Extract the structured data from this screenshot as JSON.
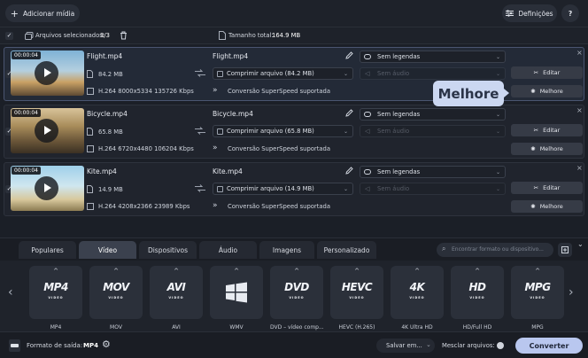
{
  "toolbar": {
    "add_media": "Adicionar mídia",
    "settings": "Definições",
    "help": "?"
  },
  "selection": {
    "label": "Arquivos selecionados:",
    "count": "3/3",
    "size_label": "Tamanho total:",
    "size_value": "164.9 MB"
  },
  "files": [
    {
      "duration": "00:00:04",
      "name": "Flight.mp4",
      "size": "84.2 MB",
      "info": "H.264 8000x5334 135726 Kbps",
      "out_name": "Flight.mp4",
      "compress": "Comprimir arquivo (84.2 MB)",
      "conv": "Conversão SuperSpeed suportada",
      "subs": "Sem legendas",
      "audio": "Sem áudio",
      "edit": "Editar",
      "enhance": "Melhore",
      "selected": true,
      "checked": true
    },
    {
      "duration": "00:00:04",
      "name": "Bicycle.mp4",
      "size": "65.8 MB",
      "info": "H.264 6720x4480 106204 Kbps",
      "out_name": "Bicycle.mp4",
      "compress": "Comprimir arquivo (65.8 MB)",
      "conv": "Conversão SuperSpeed suportada",
      "subs": "Sem legendas",
      "audio": "Sem áudio",
      "edit": "Editar",
      "enhance": "Melhore",
      "selected": false,
      "checked": true
    },
    {
      "duration": "00:00:04",
      "name": "Kite.mp4",
      "size": "14.9 MB",
      "info": "H.264 4208x2366 23989 Kbps",
      "out_name": "Kite.mp4",
      "compress": "Comprimir arquivo (14.9 MB)",
      "conv": "Conversão SuperSpeed suportada",
      "subs": "Sem legendas",
      "audio": "Sem áudio",
      "edit": "Editar",
      "enhance": "Melhore",
      "selected": false,
      "checked": true
    }
  ],
  "tooltip": "Melhore",
  "tabs": [
    "Populares",
    "Vídeo",
    "Dispositivos",
    "Áudio",
    "Imagens",
    "Personalizado"
  ],
  "active_tab": "Vídeo",
  "search": {
    "placeholder": "Encontrar formato ou dispositivo..."
  },
  "formats": [
    {
      "logo": "MP4",
      "sub": "VIDEO",
      "label": "MP4"
    },
    {
      "logo": "MOV",
      "sub": "VIDEO",
      "label": "MOV"
    },
    {
      "logo": "AVI",
      "sub": "VIDEO",
      "label": "AVI"
    },
    {
      "logo": "",
      "sub": "",
      "label": "WMV"
    },
    {
      "logo": "DVD",
      "sub": "VIDEO",
      "label": "DVD – vídeo comp..."
    },
    {
      "logo": "HEVC",
      "sub": "VIDEO",
      "label": "HEVC (H.265)"
    },
    {
      "logo": "4K",
      "sub": "VIDEO",
      "label": "4K Ultra HD"
    },
    {
      "logo": "HD",
      "sub": "VIDEO",
      "label": "HD/Full HD"
    },
    {
      "logo": "MPG",
      "sub": "VIDEO",
      "label": "MPG"
    }
  ],
  "bottom": {
    "output_label": "Formato de saída:",
    "output_value": "MP4",
    "save": "Salvar em...",
    "merge": "Mesclar arquivos:",
    "convert": "Converter"
  },
  "colors": {
    "accent": "#b9c7ef",
    "tooltip": "#cbd7f1",
    "background": "#1b1f27"
  }
}
